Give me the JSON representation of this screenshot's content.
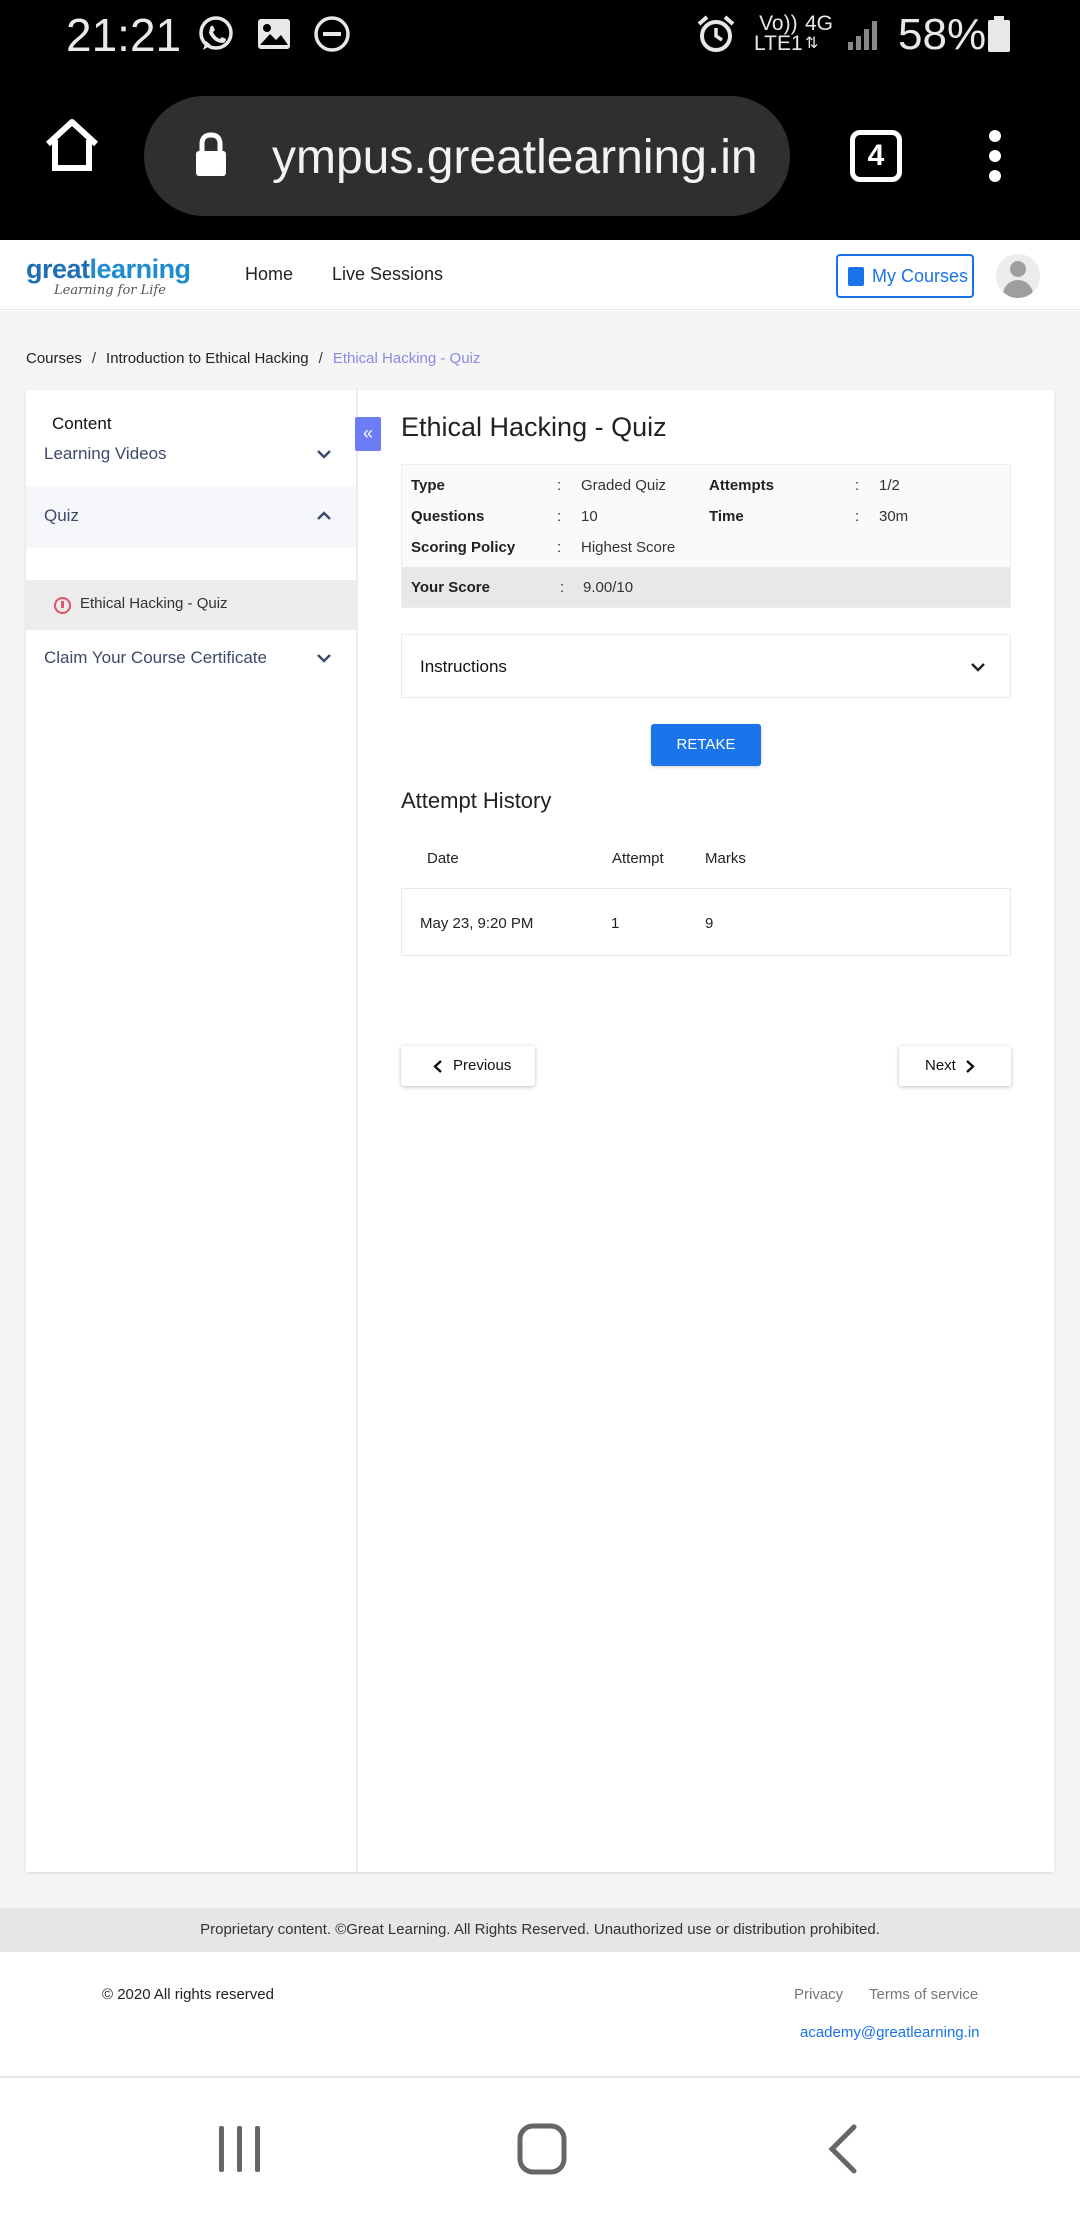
{
  "status_bar": {
    "time": "21:21",
    "network_top": "Vo))",
    "network_bottom": "LTE1",
    "network_type": "4G",
    "battery": "58%"
  },
  "browser": {
    "url": "ympus.greatlearning.in",
    "tab_count": "4"
  },
  "header": {
    "logo_part1": "great",
    "logo_part2": "learning",
    "logo_tagline": "Learning for Life",
    "nav": [
      "Home",
      "Live Sessions"
    ],
    "my_courses_label": "My Courses"
  },
  "breadcrumb": {
    "items": [
      "Courses",
      "Introduction to Ethical Hacking",
      "Ethical Hacking - Quiz"
    ],
    "separator": "/"
  },
  "sidebar": {
    "title": "Content",
    "collapse_glyph": "«",
    "sections": [
      {
        "label": "Learning Videos",
        "expanded": false
      },
      {
        "label": "Quiz",
        "expanded": true,
        "items": [
          "Ethical Hacking - Quiz"
        ]
      },
      {
        "label": "Claim Your Course Certificate",
        "expanded": false
      }
    ]
  },
  "quiz": {
    "title": "Ethical Hacking - Quiz",
    "colon": ":",
    "info": {
      "type_label": "Type",
      "type_value": "Graded Quiz",
      "attempts_label": "Attempts",
      "attempts_value": "1/2",
      "questions_label": "Questions",
      "questions_value": "10",
      "time_label": "Time",
      "time_value": "30m",
      "policy_label": "Scoring Policy",
      "policy_value": "Highest Score",
      "score_label": "Your Score",
      "score_value": "9.00/10"
    },
    "instructions_label": "Instructions",
    "retake_label": "RETAKE",
    "history_title": "Attempt History",
    "history_columns": [
      "Date",
      "Attempt",
      "Marks"
    ],
    "history_rows": [
      {
        "date": "May 23, 9:20 PM",
        "attempt": "1",
        "marks": "9"
      }
    ],
    "previous_label": "Previous",
    "next_label": "Next"
  },
  "footer": {
    "notice": "Proprietary content. ©Great Learning. All Rights Reserved. Unauthorized use or distribution prohibited.",
    "copyright": "© 2020 All rights reserved",
    "privacy": "Privacy",
    "terms": "Terms of service",
    "email": "academy@greatlearning.in"
  },
  "colors": {
    "accent": "#1a73e8",
    "breadcrumb_current": "#8a8ae6",
    "collapse_button": "#6b7cf5",
    "quiz_icon": "#e0536b"
  }
}
